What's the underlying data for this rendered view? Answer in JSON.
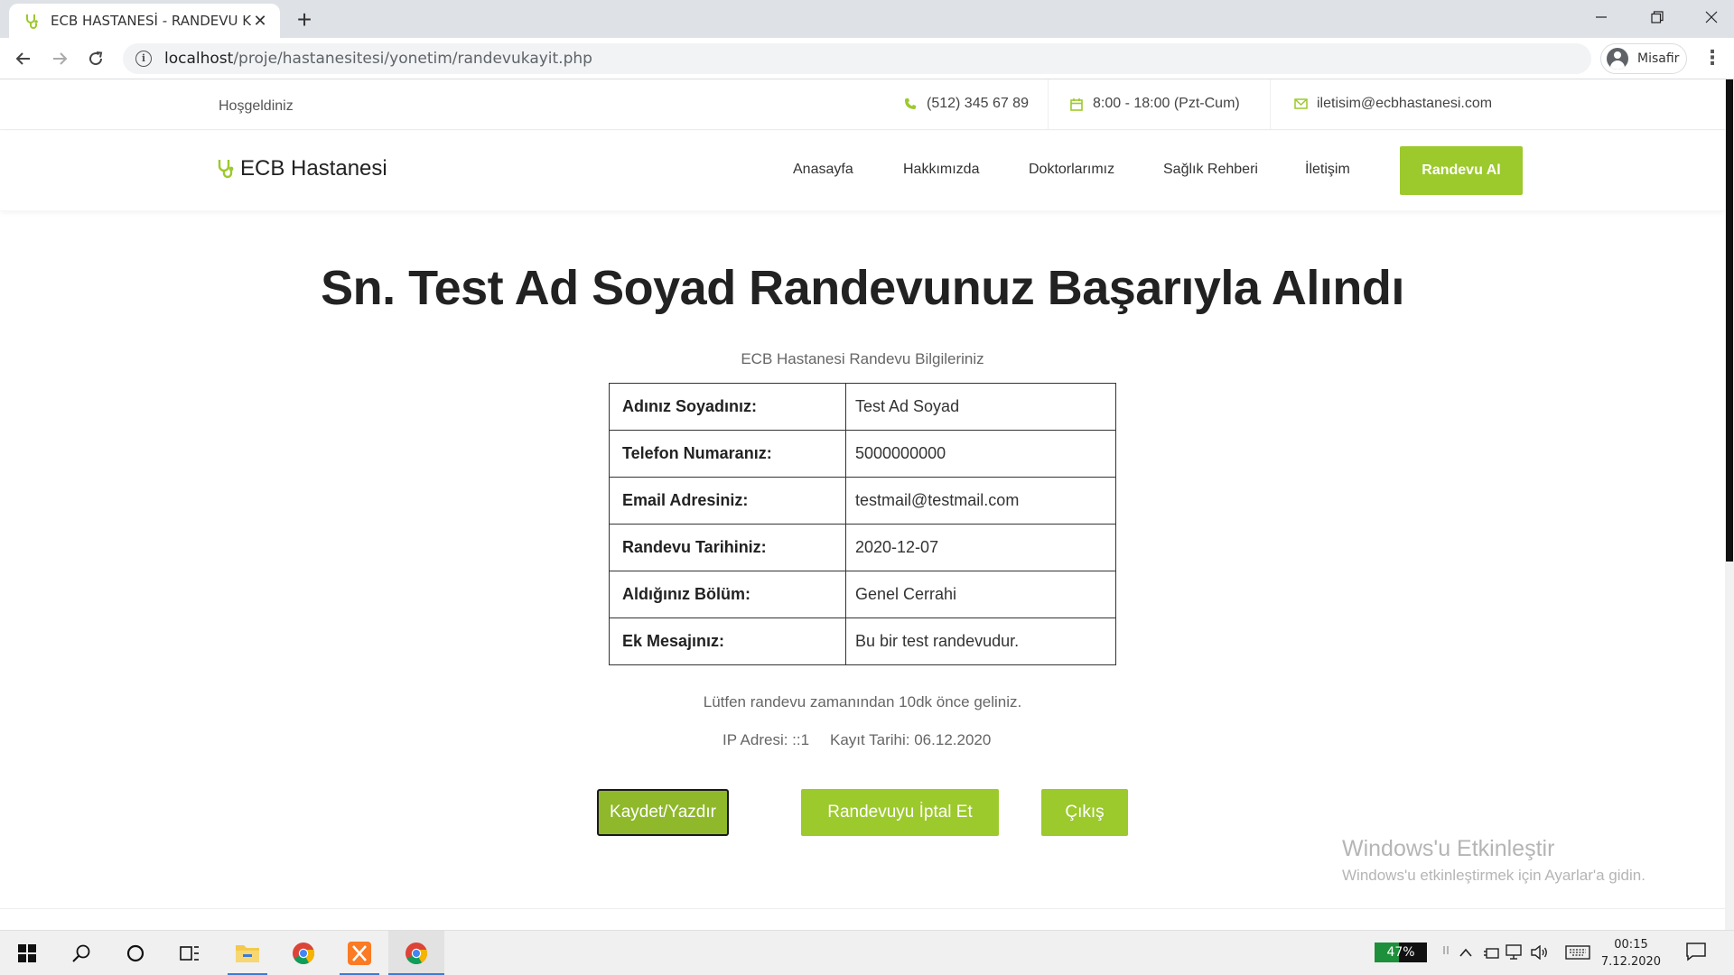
{
  "browser": {
    "tab_title": "ECB HASTANESİ - RANDEVU KAY",
    "tab_close": "✕",
    "new_tab": "+",
    "url_host": "localhost",
    "url_path": "/proje/hastanesitesi/yonetim/randevukayit.php",
    "profile_label": "Misafir",
    "menu": "⋮"
  },
  "site": {
    "welcome": "Hoşgeldiniz",
    "phone": "(512) 345 67 89",
    "hours": "8:00 - 18:00 (Pzt-Cum)",
    "email": "iletisim@ecbhastanesi.com",
    "brand": "ECB Hastanesi",
    "nav": [
      "Anasayfa",
      "Hakkımızda",
      "Doktorlarımız",
      "Sağlık Rehberi",
      "İletişim"
    ],
    "cta": "Randevu Al",
    "accent": "#9cc92c"
  },
  "main": {
    "headline": "Sn. Test Ad Soyad Randevunuz Başarıyla Alındı",
    "subline": "ECB Hastanesi Randevu Bilgileriniz",
    "rows": [
      {
        "label": "Adınız Soyadınız:",
        "value": "Test Ad Soyad"
      },
      {
        "label": "Telefon Numaranız:",
        "value": "5000000000"
      },
      {
        "label": "Email Adresiniz:",
        "value": "testmail@testmail.com"
      },
      {
        "label": "Randevu Tarihiniz:",
        "value": "2020-12-07"
      },
      {
        "label": "Aldığınız Bölüm:",
        "value": "Genel Cerrahi"
      },
      {
        "label": "Ek Mesajınız:",
        "value": "Bu bir test randevudur."
      }
    ],
    "note": "Lütfen randevu zamanından 10dk önce geliniz.",
    "ip": "IP Adresi: ::1",
    "record_date": "Kayıt Tarihi: 06.12.2020",
    "buttons": {
      "save": "Kaydet/Yazdır",
      "cancel": "Randevuyu İptal Et",
      "exit": "Çıkış"
    }
  },
  "watermark": {
    "title": "Windows'u Etkinleştir",
    "subtitle": "Windows'u etkinleştirmek için Ayarlar'a gidin."
  },
  "taskbar": {
    "battery_percent": 47,
    "battery_label": "47%",
    "time": "00:15",
    "date": "7.12.2020"
  }
}
